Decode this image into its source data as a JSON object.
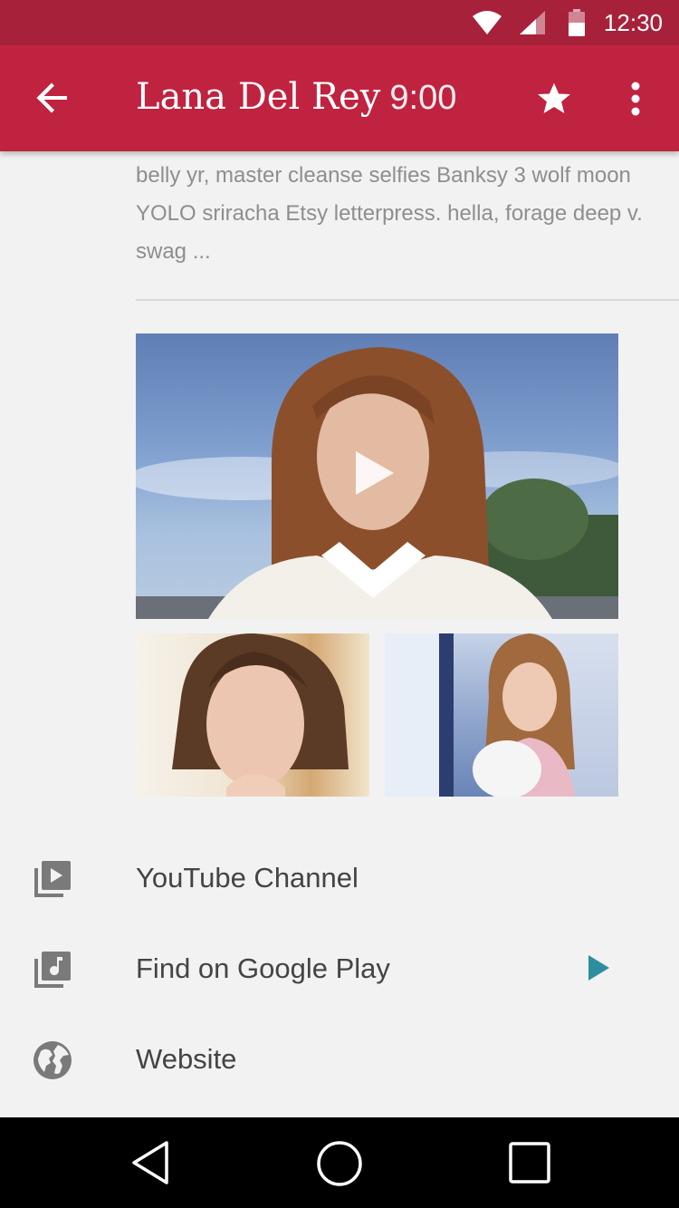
{
  "status_bar": {
    "time": "12:30",
    "icons": [
      "wifi-icon",
      "signal-icon",
      "battery-icon"
    ]
  },
  "app_bar": {
    "title": "Lana Del Rey",
    "duration": "9:00",
    "back_icon": "arrow-back-icon",
    "star_icon": "star-icon",
    "more_icon": "more-vert-icon",
    "color": "#c0233f",
    "status_color": "#a8213a"
  },
  "description": {
    "text": "belly yr, master cleanse selfies Banksy 3 wolf moon YOLO sriracha Etsy letterpress. hella, forage deep v. swag ..."
  },
  "gallery": {
    "main_image": {
      "icon": "play-icon"
    },
    "thumbnails": [
      {},
      {}
    ]
  },
  "links": [
    {
      "label": "YouTube Channel",
      "icon": "video-library-icon"
    },
    {
      "label": "Find on Google Play",
      "icon": "music-library-icon",
      "trailing_icon": "play-arrow-icon",
      "trailing_color": "#2e8ea0"
    },
    {
      "label": "Website",
      "icon": "globe-icon"
    }
  ],
  "nav_bar": {
    "buttons": [
      "back-triangle-icon",
      "home-circle-icon",
      "recents-square-icon"
    ]
  }
}
